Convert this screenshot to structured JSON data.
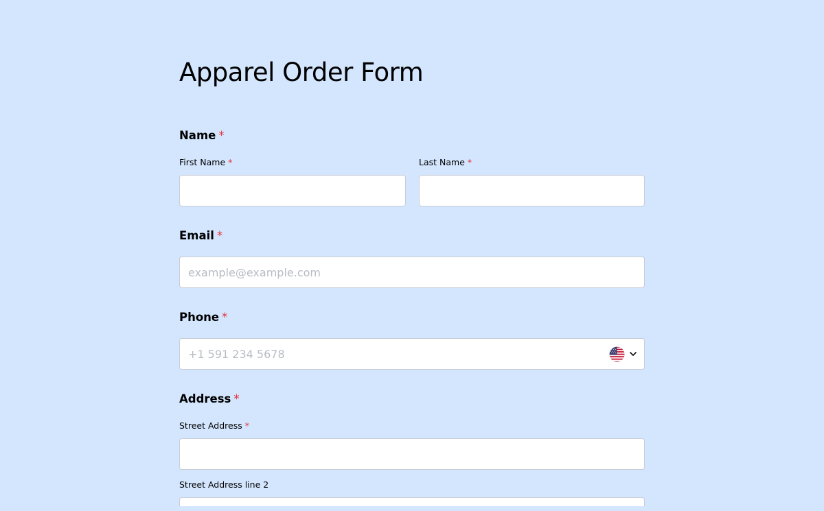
{
  "form": {
    "title": "Apparel Order Form"
  },
  "name_section": {
    "label": "Name",
    "required_mark": "*",
    "first_name": {
      "label": "First Name",
      "required_mark": "*",
      "value": "",
      "placeholder": ""
    },
    "last_name": {
      "label": "Last Name",
      "required_mark": "*",
      "value": "",
      "placeholder": ""
    }
  },
  "email_section": {
    "label": "Email",
    "required_mark": "*",
    "value": "",
    "placeholder": "example@example.com"
  },
  "phone_section": {
    "label": "Phone",
    "required_mark": "*",
    "value": "",
    "placeholder": "+1 591 234 5678",
    "country_icon": "us-flag-icon"
  },
  "address_section": {
    "label": "Address",
    "required_mark": "*",
    "street": {
      "label": "Street Address",
      "required_mark": "*",
      "value": "",
      "placeholder": ""
    },
    "street2": {
      "label": "Street Address line 2",
      "value": "",
      "placeholder": ""
    }
  },
  "colors": {
    "background": "#d3e6fe",
    "required": "#e5323b",
    "field_border": "#c7cdd6",
    "placeholder": "#b7bcc4"
  }
}
